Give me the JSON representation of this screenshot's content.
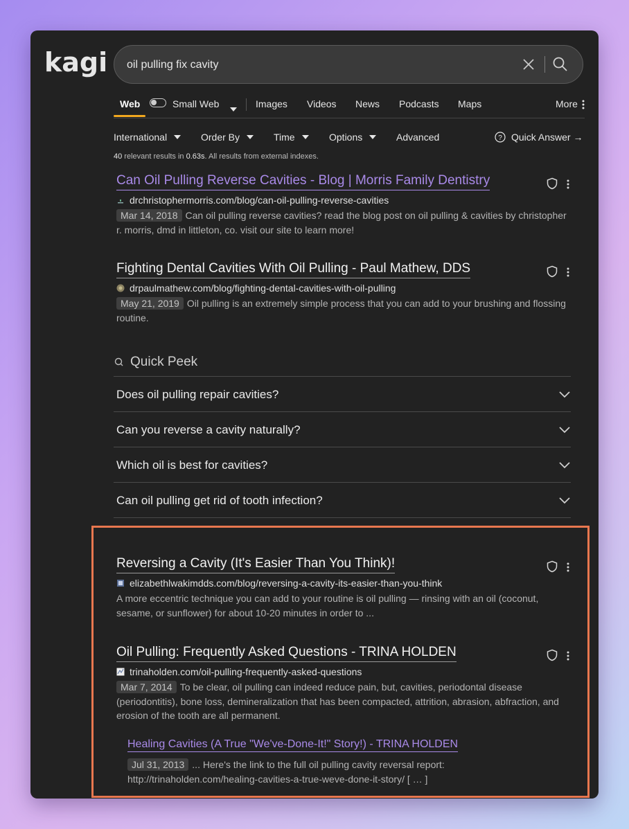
{
  "app": {
    "logo": "kagi"
  },
  "search": {
    "query": "oil pulling fix cavity"
  },
  "nav": {
    "web": "Web",
    "small_web": "Small Web",
    "images": "Images",
    "videos": "Videos",
    "news": "News",
    "podcasts": "Podcasts",
    "maps": "Maps",
    "more": "More"
  },
  "filters": {
    "international": "International",
    "order_by": "Order By",
    "time": "Time",
    "options": "Options",
    "advanced": "Advanced",
    "quick_answer": "Quick Answer →"
  },
  "stats": {
    "count": "40",
    "count_suffix": " relevant results in ",
    "time": "0.63s",
    "tail": ". All results from external indexes."
  },
  "results": [
    {
      "title": "Can Oil Pulling Reverse Cavities - Blog | Morris Family Dentistry",
      "url": "drchristophermorris.com/blog/can-oil-pulling-reverse-cavities",
      "date": "Mar 14, 2018",
      "snippet": "Can oil pulling reverse cavities? read the blog post on oil pulling & cavities by christopher r. morris, dmd in littleton, co. visit our site to learn more!"
    },
    {
      "title": "Fighting Dental Cavities With Oil Pulling - Paul Mathew, DDS",
      "url": "drpaulmathew.com/blog/fighting-dental-cavities-with-oil-pulling",
      "date": "May 21, 2019",
      "snippet": "Oil pulling is an extremely simple process that you can add to your brushing and flossing routine."
    },
    {
      "title": "Reversing a Cavity (It's Easier Than You Think)!",
      "url": "elizabethlwakimdds.com/blog/reversing-a-cavity-its-easier-than-you-think",
      "date": "",
      "snippet": "A more eccentric technique you can add to your routine is oil pulling — rinsing with an oil (coconut, sesame, or sunflower) for about 10-20 minutes in order to ..."
    },
    {
      "title": "Oil Pulling: Frequently Asked Questions - TRINA HOLDEN",
      "url": "trinaholden.com/oil-pulling-frequently-asked-questions",
      "date": "Mar 7, 2014",
      "snippet": "To be clear, oil pulling can indeed reduce pain, but, cavities, periodontal disease (periodontitis), bone loss, demineralization that has been compacted, attrition, abrasion, abfraction, and erosion of the tooth are all permanent."
    }
  ],
  "subresult": {
    "title": "Healing Cavities (A True \"We've-Done-It!\" Story!) - TRINA HOLDEN",
    "date": "Jul 31, 2013",
    "snippet": "... Here's the link to the full oil pulling cavity reversal report: http://trinaholden.com/healing-cavities-a-true-weve-done-it-story/ [ … ]"
  },
  "quick_peek": {
    "title": "Quick Peek",
    "questions": [
      "Does oil pulling repair cavities?",
      "Can you reverse a cavity naturally?",
      "Which oil is best for cavities?",
      "Can oil pulling get rid of tooth infection?"
    ]
  },
  "colors": {
    "accent": "#f1a81f",
    "visited_link": "#a98ae8",
    "highlight": "#e8774f"
  }
}
